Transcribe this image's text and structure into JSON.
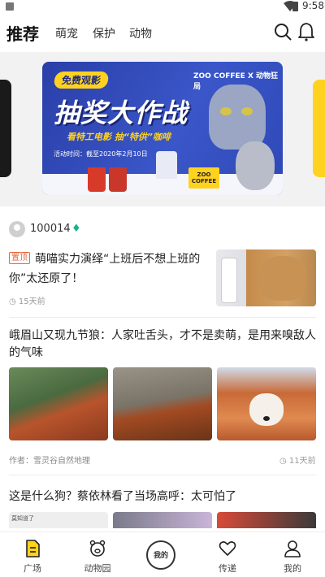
{
  "status_bar": {
    "time": "9:58"
  },
  "top_nav": {
    "tabs": [
      {
        "label": "推荐",
        "active": true
      },
      {
        "label": "萌宠",
        "active": false
      },
      {
        "label": "保护",
        "active": false
      },
      {
        "label": "动物",
        "active": false
      }
    ],
    "icons": [
      "search-icon",
      "bell-icon"
    ]
  },
  "banner": {
    "badge": "免费观影",
    "logos": "ZOO COFFEE  X  动物狂局",
    "title": "抽奖大作战",
    "subtitle": "看特工电影  抽“特供”咖啡",
    "date": "活动时间：截至2020年2月10日",
    "box_label": "ZOO COFFEE"
  },
  "feed": {
    "author": {
      "id": "100014"
    },
    "article1": {
      "tag": "置顶",
      "title": "萌喵实力演绎“上班后不想上班的你”太还原了！",
      "time": "15天前"
    },
    "article2": {
      "title": "峨眉山又现九节狼：人家吐舌头，才不是卖萌，是用来嗅敌人的气味",
      "author_line": "作者：雪灵谷自然地理",
      "time": "11天前"
    },
    "article3": {
      "title": "这是什么狗？蔡依林看了当场高呼：太可怕了",
      "thumb_text": "莫知道了"
    }
  },
  "bottom_nav": {
    "items": [
      {
        "label": "广场",
        "icon": "plaza-icon",
        "active": true
      },
      {
        "label": "动物园",
        "icon": "zoo-icon",
        "active": false
      },
      {
        "label": "",
        "icon": "center-icon",
        "center_text": "我的"
      },
      {
        "label": "传递",
        "icon": "heart-icon",
        "active": false
      },
      {
        "label": "我的",
        "icon": "profile-icon",
        "active": false
      }
    ]
  },
  "colors": {
    "accent": "#ffd21f",
    "banner_blue": "#2f48b6",
    "tag_orange": "#e8663a",
    "gem_green": "#1bb38a"
  }
}
